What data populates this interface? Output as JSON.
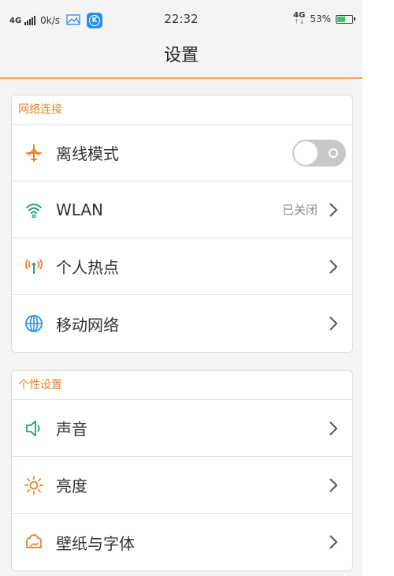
{
  "status_bar": {
    "network": "4G",
    "speed": "0k/s",
    "time": "22:32",
    "network_right": "4G",
    "battery_percent": "53%",
    "battery_level": 0.53,
    "app_badge_letter": "K"
  },
  "header": {
    "title": "设置"
  },
  "section_network": {
    "title": "网络连接",
    "items": [
      {
        "label": "离线模式",
        "icon": "airplane-icon",
        "toggle_on": false
      },
      {
        "label": "WLAN",
        "icon": "wifi-icon",
        "value": "已关闭"
      },
      {
        "label": "个人热点",
        "icon": "hotspot-icon"
      },
      {
        "label": "移动网络",
        "icon": "globe-icon"
      }
    ]
  },
  "section_personal": {
    "title": "个性设置",
    "items": [
      {
        "label": "声音",
        "icon": "speaker-icon"
      },
      {
        "label": "亮度",
        "icon": "brightness-icon"
      },
      {
        "label": "壁纸与字体",
        "icon": "wallpaper-icon"
      }
    ]
  },
  "colors": {
    "accent": "#e8832b",
    "teal": "#22a37a",
    "blue": "#2b8fe6"
  }
}
